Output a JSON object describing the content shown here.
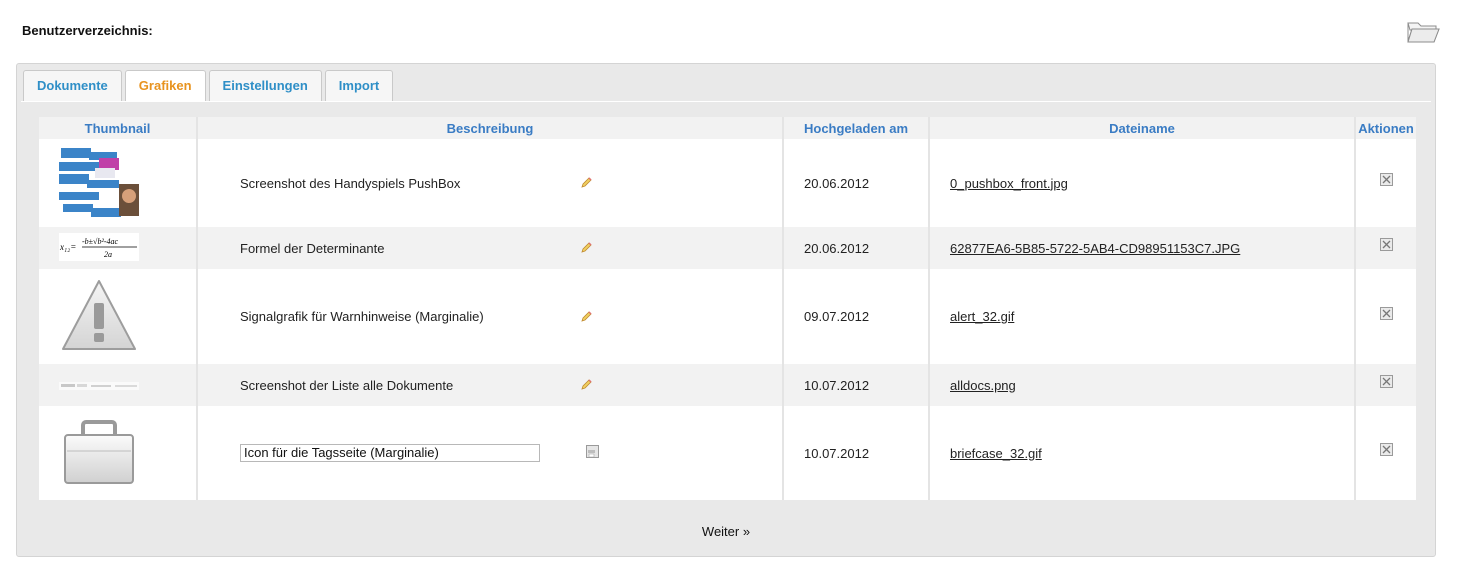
{
  "header": {
    "title": "Benutzerverzeichnis:",
    "folder_icon": "folder-open-icon"
  },
  "tabs": [
    {
      "label": "Dokumente",
      "active": false
    },
    {
      "label": "Grafiken",
      "active": true
    },
    {
      "label": "Einstellungen",
      "active": false
    },
    {
      "label": "Import",
      "active": false
    }
  ],
  "table": {
    "columns": [
      "Thumbnail",
      "Beschreibung",
      "Hochgeladen am",
      "Dateiname",
      "Aktionen"
    ],
    "rows": [
      {
        "thumbnail": "pushbox-screenshot-thumbnail",
        "description": "Screenshot des Handyspiels PushBox",
        "date": "20.06.2012",
        "filename": "0_pushbox_front.jpg",
        "editing": false
      },
      {
        "thumbnail": "formula-thumbnail",
        "description": "Formel der Determinante",
        "date": "20.06.2012",
        "filename": "62877EA6-5B85-5722-5AB4-CD98951153C7.JPG",
        "editing": false
      },
      {
        "thumbnail": "warning-triangle-thumbnail",
        "description": "Signalgrafik für Warnhinweise (Marginalie)",
        "date": "09.07.2012",
        "filename": "alert_32.gif",
        "editing": false
      },
      {
        "thumbnail": "document-list-thumbnail",
        "description": "Screenshot der Liste alle Dokumente",
        "date": "10.07.2012",
        "filename": "alldocs.png",
        "editing": false
      },
      {
        "thumbnail": "briefcase-thumbnail",
        "description": "Icon für die Tagsseite (Marginalie)",
        "date": "10.07.2012",
        "filename": "briefcase_32.gif",
        "editing": true
      }
    ]
  },
  "pager": {
    "next_label": "Weiter »"
  },
  "colors": {
    "accent_blue": "#3a7cc4",
    "tab_active": "#e8931f",
    "tab_inactive": "#2f8fc7"
  }
}
